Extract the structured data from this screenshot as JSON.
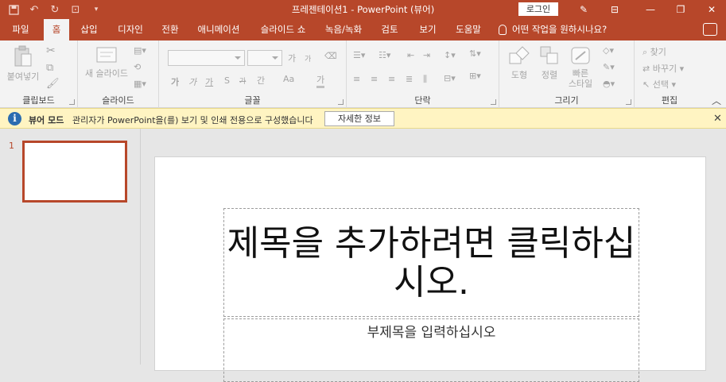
{
  "window": {
    "title": "프레젠테이션1  -  PowerPoint (뷰어)",
    "login": "로그인"
  },
  "tabs": [
    "파일",
    "홈",
    "삽입",
    "디자인",
    "전환",
    "애니메이션",
    "슬라이드 쇼",
    "녹음/녹화",
    "검토",
    "보기",
    "도움말"
  ],
  "tell_me": "어떤 작업을 원하시나요?",
  "ribbon": {
    "clipboard": {
      "label": "클립보드",
      "paste": "붙여넣기"
    },
    "slides": {
      "label": "슬라이드",
      "new_slide": "새 슬라이드"
    },
    "font": {
      "label": "글꼴",
      "grow": "가",
      "shrink": "가",
      "bold": "가",
      "italic": "가",
      "underline": "가",
      "shadow": "S",
      "strike": "가",
      "spacing": "간",
      "case": "Aa",
      "color": "가"
    },
    "paragraph": {
      "label": "단락"
    },
    "drawing": {
      "label": "그리기",
      "shapes": "도형",
      "arrange": "정렬",
      "quick_styles": "빠른",
      "quick_styles_2": "스타일"
    },
    "editing": {
      "label": "편집",
      "find": "찾기",
      "replace": "바꾸기",
      "select": "선택"
    }
  },
  "infobar": {
    "mode": "뷰어 모드",
    "message": "관리자가 PowerPoint을(를) 보기 및 인쇄 전용으로 구성했습니다",
    "details": "자세한 정보"
  },
  "slides_pane": {
    "number": "1"
  },
  "slide": {
    "title_placeholder": "제목을 추가하려면 클릭하십시오.",
    "subtitle_placeholder": "부제목을 입력하십시오"
  }
}
